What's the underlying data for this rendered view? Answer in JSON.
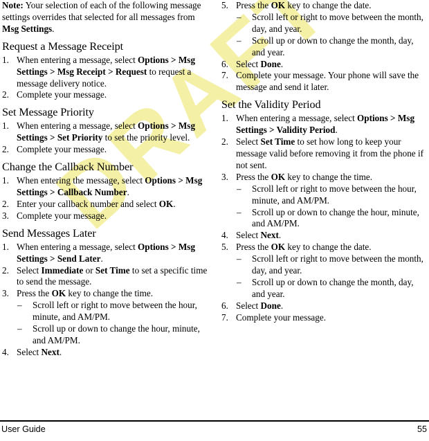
{
  "page": {
    "footer_left": "User Guide",
    "footer_page_number": "55",
    "watermark_text": "DRAFT",
    "watermark_color": "#f4f0a6"
  },
  "left_column": {
    "note": {
      "label": "Note:",
      "text_1": " Your selection of each of the following message settings overrides that selected for all messages from ",
      "bold_1": "Msg Settings",
      "text_2": "."
    },
    "sections": [
      {
        "heading": "Request a Message Receipt",
        "steps": [
          {
            "num": "1.",
            "parts": [
              {
                "t": "When entering a message, select ",
                "b": false
              },
              {
                "t": "Options",
                "b": true
              },
              {
                "t": " > ",
                "b": true
              },
              {
                "t": "Msg Settings",
                "b": true
              },
              {
                "t": " > ",
                "b": true
              },
              {
                "t": "Msg Receipt",
                "b": true
              },
              {
                "t": " > ",
                "b": true
              },
              {
                "t": "Request",
                "b": true
              },
              {
                "t": " to request a message delivery notice.",
                "b": false
              }
            ]
          },
          {
            "num": "2.",
            "parts": [
              {
                "t": "Complete your message.",
                "b": false
              }
            ]
          }
        ]
      },
      {
        "heading": "Set Message Priority",
        "steps": [
          {
            "num": "1.",
            "parts": [
              {
                "t": "When entering a message, select ",
                "b": false
              },
              {
                "t": "Options",
                "b": true
              },
              {
                "t": " > ",
                "b": true
              },
              {
                "t": "Msg Settings",
                "b": true
              },
              {
                "t": " > ",
                "b": true
              },
              {
                "t": "Set Priority",
                "b": true
              },
              {
                "t": " to set the priority level.",
                "b": false
              }
            ]
          },
          {
            "num": "2.",
            "parts": [
              {
                "t": "Complete your message.",
                "b": false
              }
            ]
          }
        ]
      },
      {
        "heading": "Change the Callback Number",
        "steps": [
          {
            "num": "1.",
            "parts": [
              {
                "t": "When entering the message, select ",
                "b": false
              },
              {
                "t": "Options",
                "b": true
              },
              {
                "t": " > ",
                "b": true
              },
              {
                "t": "Msg Settings",
                "b": true
              },
              {
                "t": " > ",
                "b": true
              },
              {
                "t": "Callback Number",
                "b": true
              },
              {
                "t": ".",
                "b": false
              }
            ]
          },
          {
            "num": "2.",
            "parts": [
              {
                "t": "Enter your callback number and select ",
                "b": false
              },
              {
                "t": "OK",
                "b": true
              },
              {
                "t": ".",
                "b": false
              }
            ]
          },
          {
            "num": "3.",
            "parts": [
              {
                "t": "Complete your message.",
                "b": false
              }
            ]
          }
        ]
      },
      {
        "heading": "Send Messages Later",
        "steps": [
          {
            "num": "1.",
            "parts": [
              {
                "t": "When entering a message, select ",
                "b": false
              },
              {
                "t": "Options",
                "b": true
              },
              {
                "t": " > ",
                "b": true
              },
              {
                "t": "Msg Settings",
                "b": true
              },
              {
                "t": " > ",
                "b": true
              },
              {
                "t": "Send Later",
                "b": true
              },
              {
                "t": ".",
                "b": false
              }
            ]
          },
          {
            "num": "2.",
            "parts": [
              {
                "t": "Select ",
                "b": false
              },
              {
                "t": "Immediate",
                "b": true
              },
              {
                "t": " or ",
                "b": false
              },
              {
                "t": "Set Time",
                "b": true
              },
              {
                "t": " to set a specific time to send the message.",
                "b": false
              }
            ]
          },
          {
            "num": "3.",
            "parts": [
              {
                "t": "Press the ",
                "b": false
              },
              {
                "t": "OK",
                "b": true
              },
              {
                "t": " key to change the time.",
                "b": false
              }
            ],
            "subs": [
              "Scroll left or right to move between the hour, minute, and AM/PM.",
              "Scroll up or down to change the hour, minute, and AM/PM."
            ]
          },
          {
            "num": "4.",
            "parts": [
              {
                "t": "Select ",
                "b": false
              },
              {
                "t": "Next",
                "b": true
              },
              {
                "t": ".",
                "b": false
              }
            ]
          }
        ]
      }
    ]
  },
  "right_column": {
    "continued_steps": [
      {
        "num": "5.",
        "parts": [
          {
            "t": "Press the ",
            "b": false
          },
          {
            "t": "OK",
            "b": true
          },
          {
            "t": " key to change the date.",
            "b": false
          }
        ],
        "subs": [
          "Scroll left or right to move between the month, day, and year.",
          "Scroll up or down to change the month, day, and year."
        ]
      },
      {
        "num": "6.",
        "parts": [
          {
            "t": "Select ",
            "b": false
          },
          {
            "t": "Done",
            "b": true
          },
          {
            "t": ".",
            "b": false
          }
        ]
      },
      {
        "num": "7.",
        "parts": [
          {
            "t": "Complete your message. Your phone will save the message and send it later.",
            "b": false
          }
        ]
      }
    ],
    "sections": [
      {
        "heading": "Set the Validity Period",
        "steps": [
          {
            "num": "1.",
            "parts": [
              {
                "t": "When entering a message, select ",
                "b": false
              },
              {
                "t": "Options",
                "b": true
              },
              {
                "t": " > ",
                "b": true
              },
              {
                "t": "Msg Settings",
                "b": true
              },
              {
                "t": " > ",
                "b": true
              },
              {
                "t": "Validity Period",
                "b": true
              },
              {
                "t": ".",
                "b": false
              }
            ]
          },
          {
            "num": "2.",
            "parts": [
              {
                "t": "Select ",
                "b": false
              },
              {
                "t": "Set Time",
                "b": true
              },
              {
                "t": " to set how long to keep your message valid before removing it from the phone if not sent.",
                "b": false
              }
            ]
          },
          {
            "num": "3.",
            "parts": [
              {
                "t": "Press the ",
                "b": false
              },
              {
                "t": "OK",
                "b": true
              },
              {
                "t": " key to change the time.",
                "b": false
              }
            ],
            "subs": [
              "Scroll left or right to move between the hour, minute, and AM/PM.",
              "Scroll up or down to change the hour, minute, and AM/PM."
            ]
          },
          {
            "num": "4.",
            "parts": [
              {
                "t": "Select ",
                "b": false
              },
              {
                "t": "Next",
                "b": true
              },
              {
                "t": ".",
                "b": false
              }
            ]
          },
          {
            "num": "5.",
            "parts": [
              {
                "t": "Press the ",
                "b": false
              },
              {
                "t": "OK",
                "b": true
              },
              {
                "t": " key to change the date.",
                "b": false
              }
            ],
            "subs": [
              "Scroll left or right to move between the month, day, and year.",
              "Scroll up or down to change the month, day, and year."
            ]
          },
          {
            "num": "6.",
            "parts": [
              {
                "t": "Select ",
                "b": false
              },
              {
                "t": "Done",
                "b": true
              },
              {
                "t": ".",
                "b": false
              }
            ]
          },
          {
            "num": "7.",
            "parts": [
              {
                "t": "Complete your message.",
                "b": false
              }
            ]
          }
        ]
      }
    ]
  }
}
